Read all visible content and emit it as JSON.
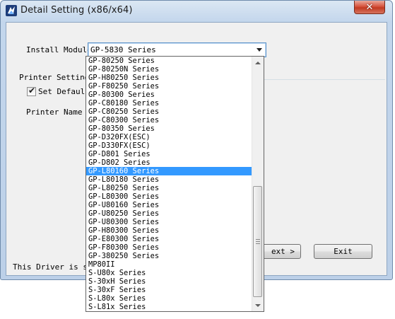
{
  "window": {
    "title": "Detail Setting (x86/x64)",
    "close_label": "✕"
  },
  "form": {
    "install_module_label": "Install Module",
    "install_module_value": "GP-5830 Series",
    "printer_setting_label": "Printer Setting",
    "set_default_label": "Set Default",
    "set_default_checked": true,
    "printer_name_label": "Printer Name",
    "footer_text": "This Driver is sui"
  },
  "buttons": {
    "next_label": "ext >",
    "exit_label": "Exit"
  },
  "dropdown": {
    "selected_index": 13,
    "items": [
      "GP-80250 Series",
      "GP-80250N Series",
      "GP-H80250 Series",
      "GP-F80250 Series",
      "GP-80300 Series",
      "GP-C80180 Series",
      "GP-C80250 Series",
      "GP-C80300 Series",
      "GP-80350 Series",
      "GP-D320FX(ESC)",
      "GP-D330FX(ESC)",
      "GP-D801 Series",
      "GP-D802 Series",
      "GP-L80160 Series",
      "GP-L80180 Series",
      "GP-L80250 Series",
      "GP-L80300 Series",
      "GP-U80160 Series",
      "GP-U80250 Series",
      "GP-U80300 Series",
      "GP-H80300 Series",
      "GP-E80300 Series",
      "GP-F80300 Series",
      "GP-380250 Series",
      "MP80II",
      "S-U80x Series",
      "S-30xH Series",
      "S-30xF Series",
      "S-L80x Series",
      "S-L81x Series"
    ]
  }
}
